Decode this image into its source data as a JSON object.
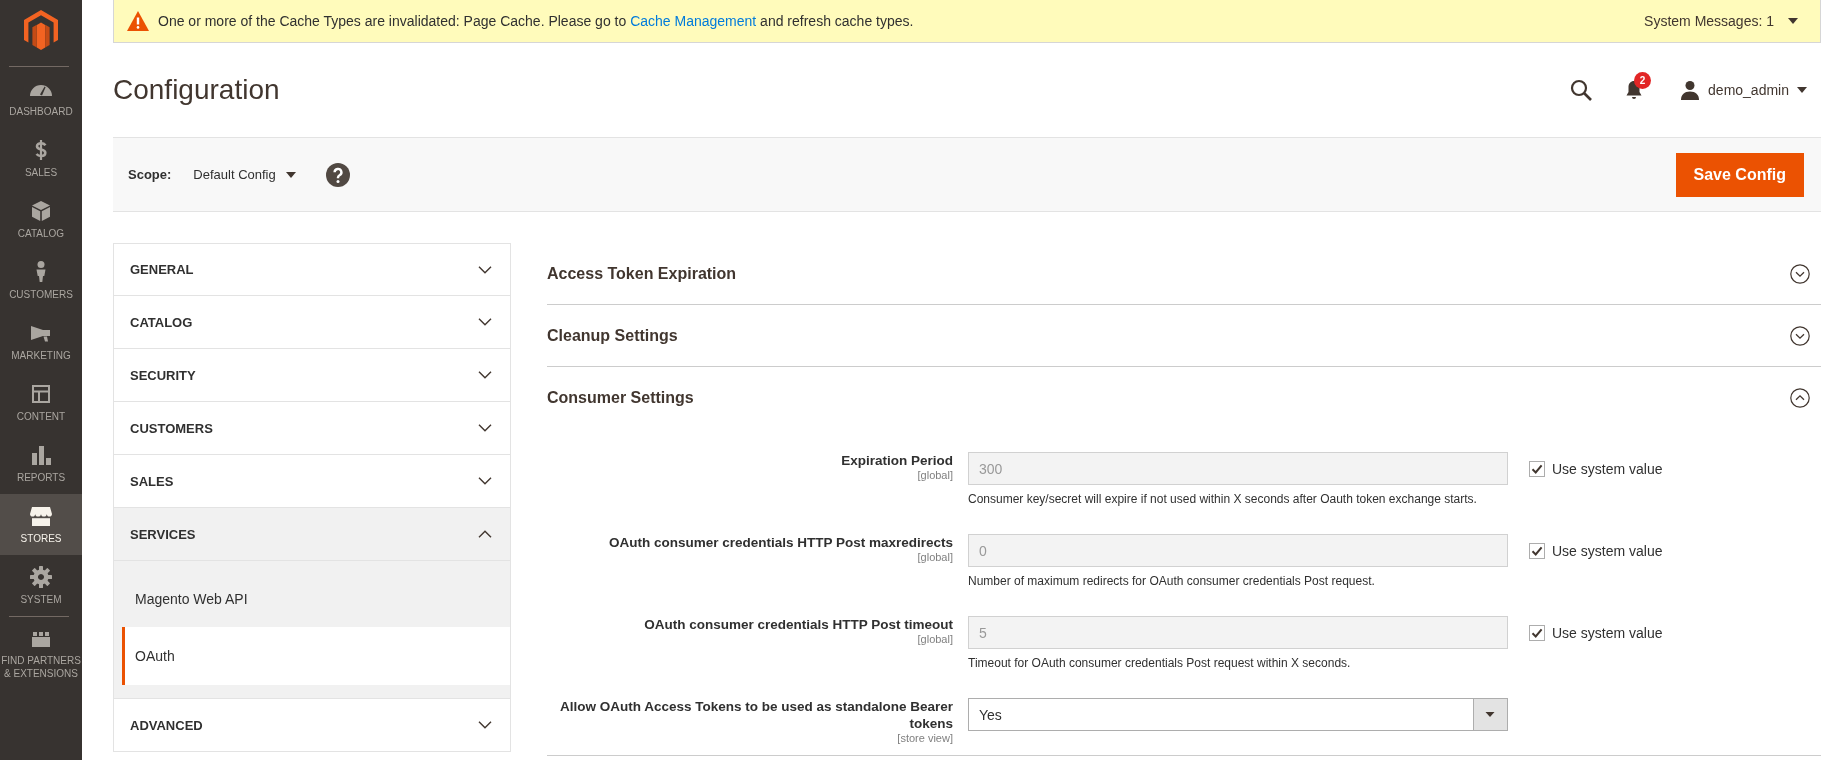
{
  "sidebar": {
    "items": [
      {
        "label": "DASHBOARD",
        "selected": false
      },
      {
        "label": "SALES",
        "selected": false
      },
      {
        "label": "CATALOG",
        "selected": false
      },
      {
        "label": "CUSTOMERS",
        "selected": false
      },
      {
        "label": "MARKETING",
        "selected": false
      },
      {
        "label": "CONTENT",
        "selected": false
      },
      {
        "label": "REPORTS",
        "selected": false
      },
      {
        "label": "STORES",
        "selected": true
      },
      {
        "label": "SYSTEM",
        "selected": false
      }
    ],
    "partners_link": {
      "label": "FIND PARTNERS & EXTENSIONS",
      "selected": false
    }
  },
  "system_message": {
    "text_before": "One or more of the Cache Types are invalidated: Page Cache. Please go to ",
    "link": "Cache Management",
    "text_after": " and refresh cache types.",
    "toggle": "System Messages: 1"
  },
  "header": {
    "title": "Configuration",
    "notifications": {
      "count": "2"
    },
    "user": {
      "name": "demo_admin"
    }
  },
  "scope_bar": {
    "label": "Scope:",
    "value": "Default Config",
    "save_button": "Save Config"
  },
  "config_nav": {
    "sections": [
      {
        "label": "GENERAL",
        "expanded": false
      },
      {
        "label": "CATALOG",
        "expanded": false
      },
      {
        "label": "SECURITY",
        "expanded": false
      },
      {
        "label": "CUSTOMERS",
        "expanded": false
      },
      {
        "label": "SALES",
        "expanded": false
      },
      {
        "label": "SERVICES",
        "expanded": true,
        "children": [
          {
            "label": "Magento Web API",
            "selected": false
          },
          {
            "label": "OAuth",
            "selected": true
          }
        ]
      },
      {
        "label": "ADVANCED",
        "expanded": false
      }
    ]
  },
  "groups": [
    {
      "title": "Access Token Expiration",
      "expanded": false
    },
    {
      "title": "Cleanup Settings",
      "expanded": false
    },
    {
      "title": "Consumer Settings",
      "expanded": true,
      "fields": [
        {
          "kind": "text",
          "label": "Expiration Period",
          "scope": "[global]",
          "value": "300",
          "disabled": true,
          "note": "Consumer key/secret will expire if not used within X seconds after Oauth token exchange starts.",
          "use_system_value": {
            "label": "Use system value",
            "checked": true
          }
        },
        {
          "kind": "text",
          "label": "OAuth consumer credentials HTTP Post maxredirects",
          "scope": "[global]",
          "value": "0",
          "disabled": true,
          "note": "Number of maximum redirects for OAuth consumer credentials Post request.",
          "use_system_value": {
            "label": "Use system value",
            "checked": true
          }
        },
        {
          "kind": "text",
          "label": "OAuth consumer credentials HTTP Post timeout",
          "scope": "[global]",
          "value": "5",
          "disabled": true,
          "note": "Timeout for OAuth consumer credentials Post request within X seconds.",
          "use_system_value": {
            "label": "Use system value",
            "checked": true
          }
        },
        {
          "kind": "select",
          "label": "Allow OAuth Access Tokens to be used as standalone Bearer tokens",
          "scope": "[store view]",
          "value": "Yes",
          "disabled": false
        }
      ]
    }
  ]
}
